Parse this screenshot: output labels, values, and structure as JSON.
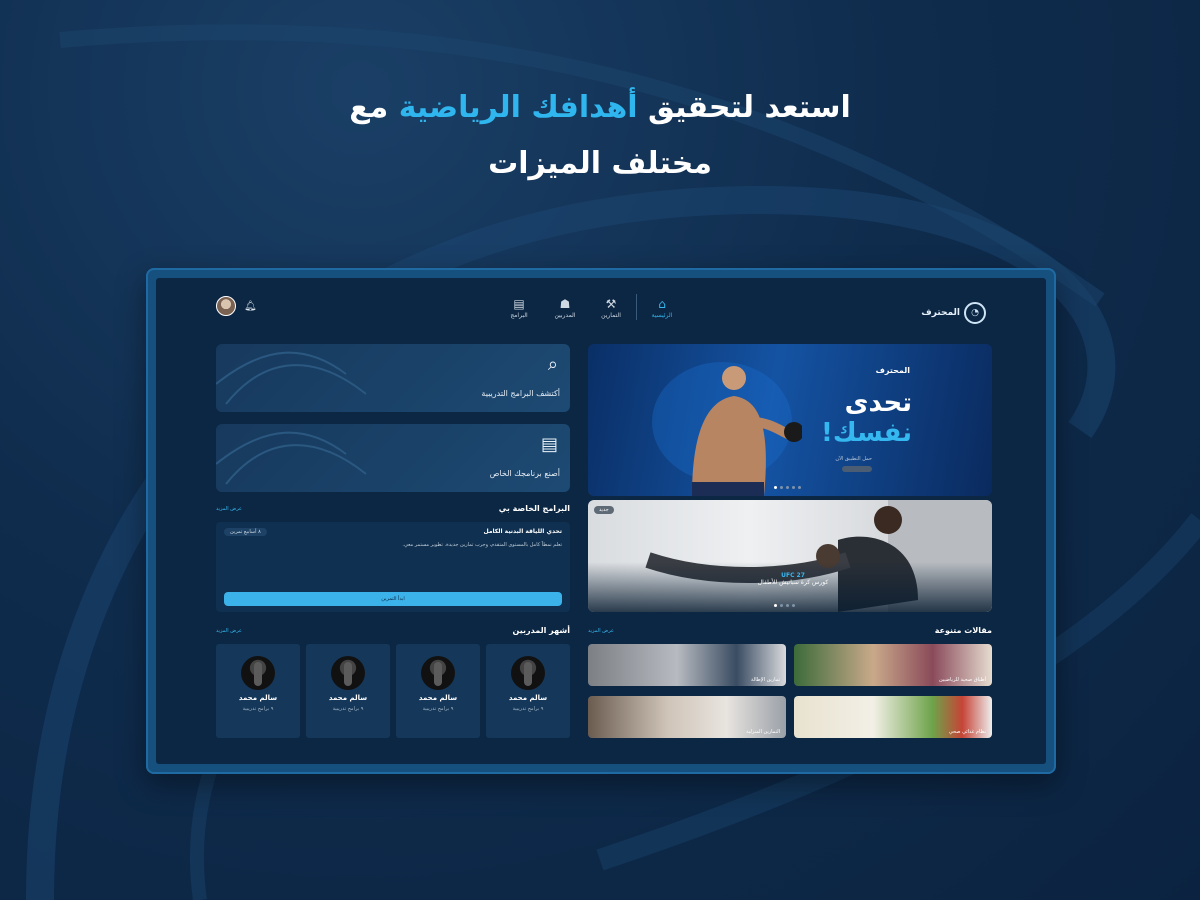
{
  "headline": {
    "line1_part1": "استعد لتحقيق ",
    "line1_highlight": "أهدافك الرياضية",
    "line1_part2": " مع",
    "line2": "مختلف الميزات"
  },
  "colors": {
    "accent": "#35b7ef",
    "background": "#0f2c4d",
    "panel": "#16507e"
  },
  "app": {
    "logo_text": "المحترف",
    "nav": [
      {
        "label": "الرئيسية",
        "icon": "home-icon",
        "active": true
      },
      {
        "label": "التمارين",
        "icon": "dumbbell-icon",
        "active": false
      },
      {
        "label": "المدربين",
        "icon": "trainers-icon",
        "active": false
      },
      {
        "label": "البرامج",
        "icon": "clipboard-icon",
        "active": false
      }
    ],
    "user": {
      "avatar_icon": "user-avatar",
      "bell_icon": "bell-icon"
    },
    "hero": {
      "brand": "المحترف",
      "title_line1": "تحدى",
      "title_line2": "نفسك!",
      "subtitle": "حمل التطبيق الآن"
    },
    "search_card": {
      "label": "أكتشف البرامج التدريبية",
      "icon": "search-icon"
    },
    "create_card": {
      "label": "أصنع برنامجك الخاص",
      "icon": "clipboard-icon"
    },
    "banner2": {
      "tag": "جديد",
      "caption_highlight": "UFC 27",
      "caption": "كورس كرة سبانيش للأطفال"
    },
    "my_programs": {
      "title": "البرامج الخاصة بي",
      "more": "عرض المزيد",
      "program_name": "تحدي اللياقة البدنية الكامل",
      "badge": "٨ أسابيع تمرين",
      "description": "تعلم نمطاً كامل بالمستوى المتقدم، وجرب تمارين جديدة. تطوير مستمر معي.",
      "start_button": "ابدأ التمرين"
    },
    "top_trainers": {
      "title": "أشهر المدربين",
      "more": "عرض المزيد",
      "items": [
        {
          "name": "سالم محمد",
          "programs": "٩ برامج تدريبية"
        },
        {
          "name": "سالم محمد",
          "programs": "٩ برامج تدريبية"
        },
        {
          "name": "سالم محمد",
          "programs": "٩ برامج تدريبية"
        },
        {
          "name": "سالم محمد",
          "programs": "٩ برامج تدريبية"
        }
      ]
    },
    "articles": {
      "title": "مقالات متنوعة",
      "more": "عرض المزيد",
      "items": [
        {
          "label": "أطباق صحية للرياضيين"
        },
        {
          "label": "تمارين الإطالة"
        },
        {
          "label": "نظام غذائي صحي"
        },
        {
          "label": "التمارين المنزلية"
        }
      ]
    }
  }
}
